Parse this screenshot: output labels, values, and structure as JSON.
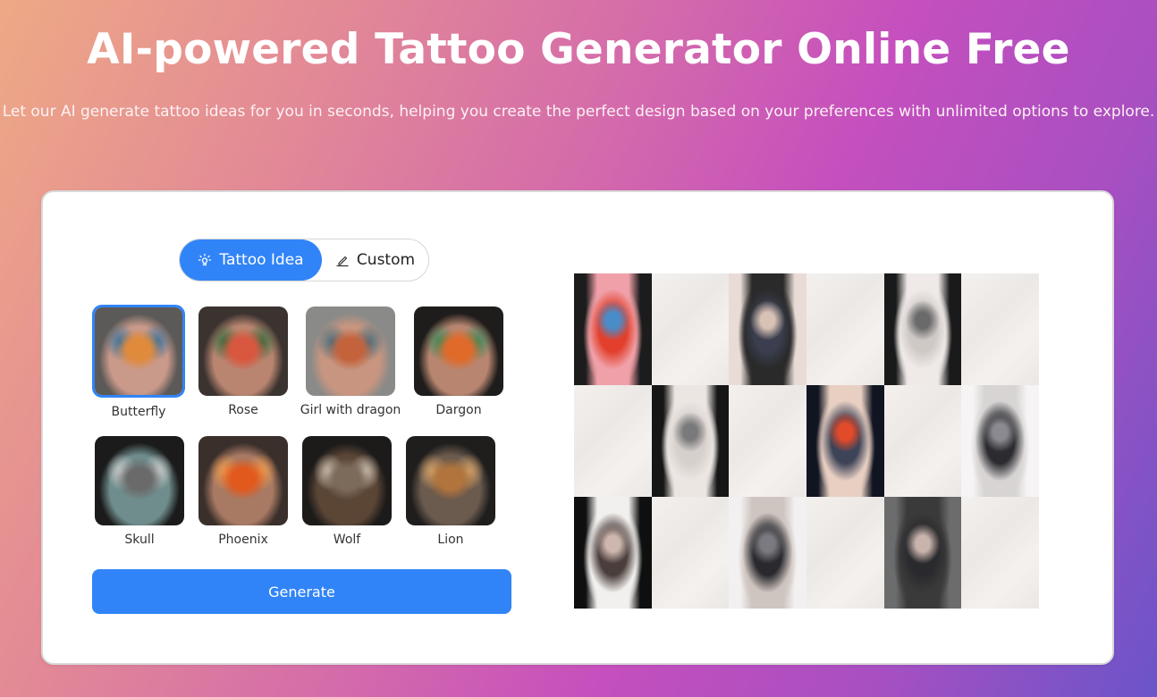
{
  "hero": {
    "title": "AI-powered Tattoo Generator Online Free",
    "subtitle": "Let our AI generate tattoo ideas for you in seconds, helping you create the perfect design based on your preferences with unlimited options to explore."
  },
  "mode_toggle": {
    "options": [
      {
        "label": "Tattoo Idea",
        "icon": "lightbulb-icon",
        "active": true
      },
      {
        "label": "Custom",
        "icon": "pencil-icon",
        "active": false
      }
    ]
  },
  "ideas": [
    {
      "label": "Butterfly",
      "selected": true,
      "palette": [
        "#5c5a58",
        "#e08a3c",
        "#2a6fa0",
        "#c9998a"
      ]
    },
    {
      "label": "Rose",
      "selected": false,
      "palette": [
        "#3b3330",
        "#d9573e",
        "#2e6a3c",
        "#b98570"
      ]
    },
    {
      "label": "Girl with dragon",
      "selected": false,
      "palette": [
        "#8a8a88",
        "#c4623c",
        "#3d6d80",
        "#c79580"
      ]
    },
    {
      "label": "Dargon",
      "selected": false,
      "palette": [
        "#1f1d1c",
        "#e06a2a",
        "#2f8a5a",
        "#b88670"
      ]
    },
    {
      "label": "Skull",
      "selected": false,
      "palette": [
        "#1b1b1b",
        "#6a6a6a",
        "#d0cfcf",
        "#6f8d8c"
      ]
    },
    {
      "label": "Phoenix",
      "selected": false,
      "palette": [
        "#3a2f2a",
        "#e2591e",
        "#f09a4a",
        "#a87a64"
      ]
    },
    {
      "label": "Wolf",
      "selected": false,
      "palette": [
        "#1d1b1a",
        "#7c6a5a",
        "#d2c7b8",
        "#5b4636"
      ]
    },
    {
      "label": "Lion",
      "selected": false,
      "palette": [
        "#1f1e1d",
        "#b0743c",
        "#d9a66a",
        "#6b5a4e"
      ]
    }
  ],
  "generate_button": {
    "label": "Generate"
  },
  "gallery": {
    "cells": [
      {
        "type": "tattoo",
        "subject": "dragon-back",
        "palette": [
          "#1c1c1c",
          "#e2402c",
          "#4a8cc8",
          "#f0a0a8"
        ]
      },
      {
        "type": "blank"
      },
      {
        "type": "tattoo",
        "subject": "wings-back",
        "palette": [
          "#e9dcd6",
          "#3a3e4e",
          "#d8c2b6",
          "#2a2a2a"
        ]
      },
      {
        "type": "blank"
      },
      {
        "type": "tattoo",
        "subject": "skull-arm",
        "palette": [
          "#1a1a1a",
          "#cfc9c6",
          "#6a6a6a",
          "#efeae8"
        ]
      },
      {
        "type": "blank"
      },
      {
        "type": "blank"
      },
      {
        "type": "tattoo",
        "subject": "skull-arm",
        "palette": [
          "#161616",
          "#d6d0cd",
          "#7a7a7a",
          "#ece6e3"
        ]
      },
      {
        "type": "blank"
      },
      {
        "type": "tattoo",
        "subject": "phoenix-back",
        "palette": [
          "#111522",
          "#3e4458",
          "#e24a2a",
          "#e8cfc2"
        ]
      },
      {
        "type": "blank"
      },
      {
        "type": "tattoo",
        "subject": "wolf-arm",
        "palette": [
          "#f6f4f4",
          "#2c2c30",
          "#8a8a90",
          "#d8d4d4"
        ]
      },
      {
        "type": "tattoo",
        "subject": "lion-arm",
        "palette": [
          "#0f0f0f",
          "#4a3e3c",
          "#cdb7ae",
          "#f2f0ee"
        ]
      },
      {
        "type": "blank"
      },
      {
        "type": "tattoo",
        "subject": "wolf-arm",
        "palette": [
          "#f2f0f0",
          "#2a2a2e",
          "#7a7a80",
          "#cfc5c0"
        ]
      },
      {
        "type": "blank"
      },
      {
        "type": "tattoo",
        "subject": "lion-arm",
        "palette": [
          "#6c6c6c",
          "#2a2a2e",
          "#c9b4ac",
          "#3a3a3a"
        ]
      },
      {
        "type": "blank"
      }
    ]
  },
  "colors": {
    "accent": "#3184f7",
    "card_bg": "#ffffff",
    "text_dark": "#333333"
  }
}
